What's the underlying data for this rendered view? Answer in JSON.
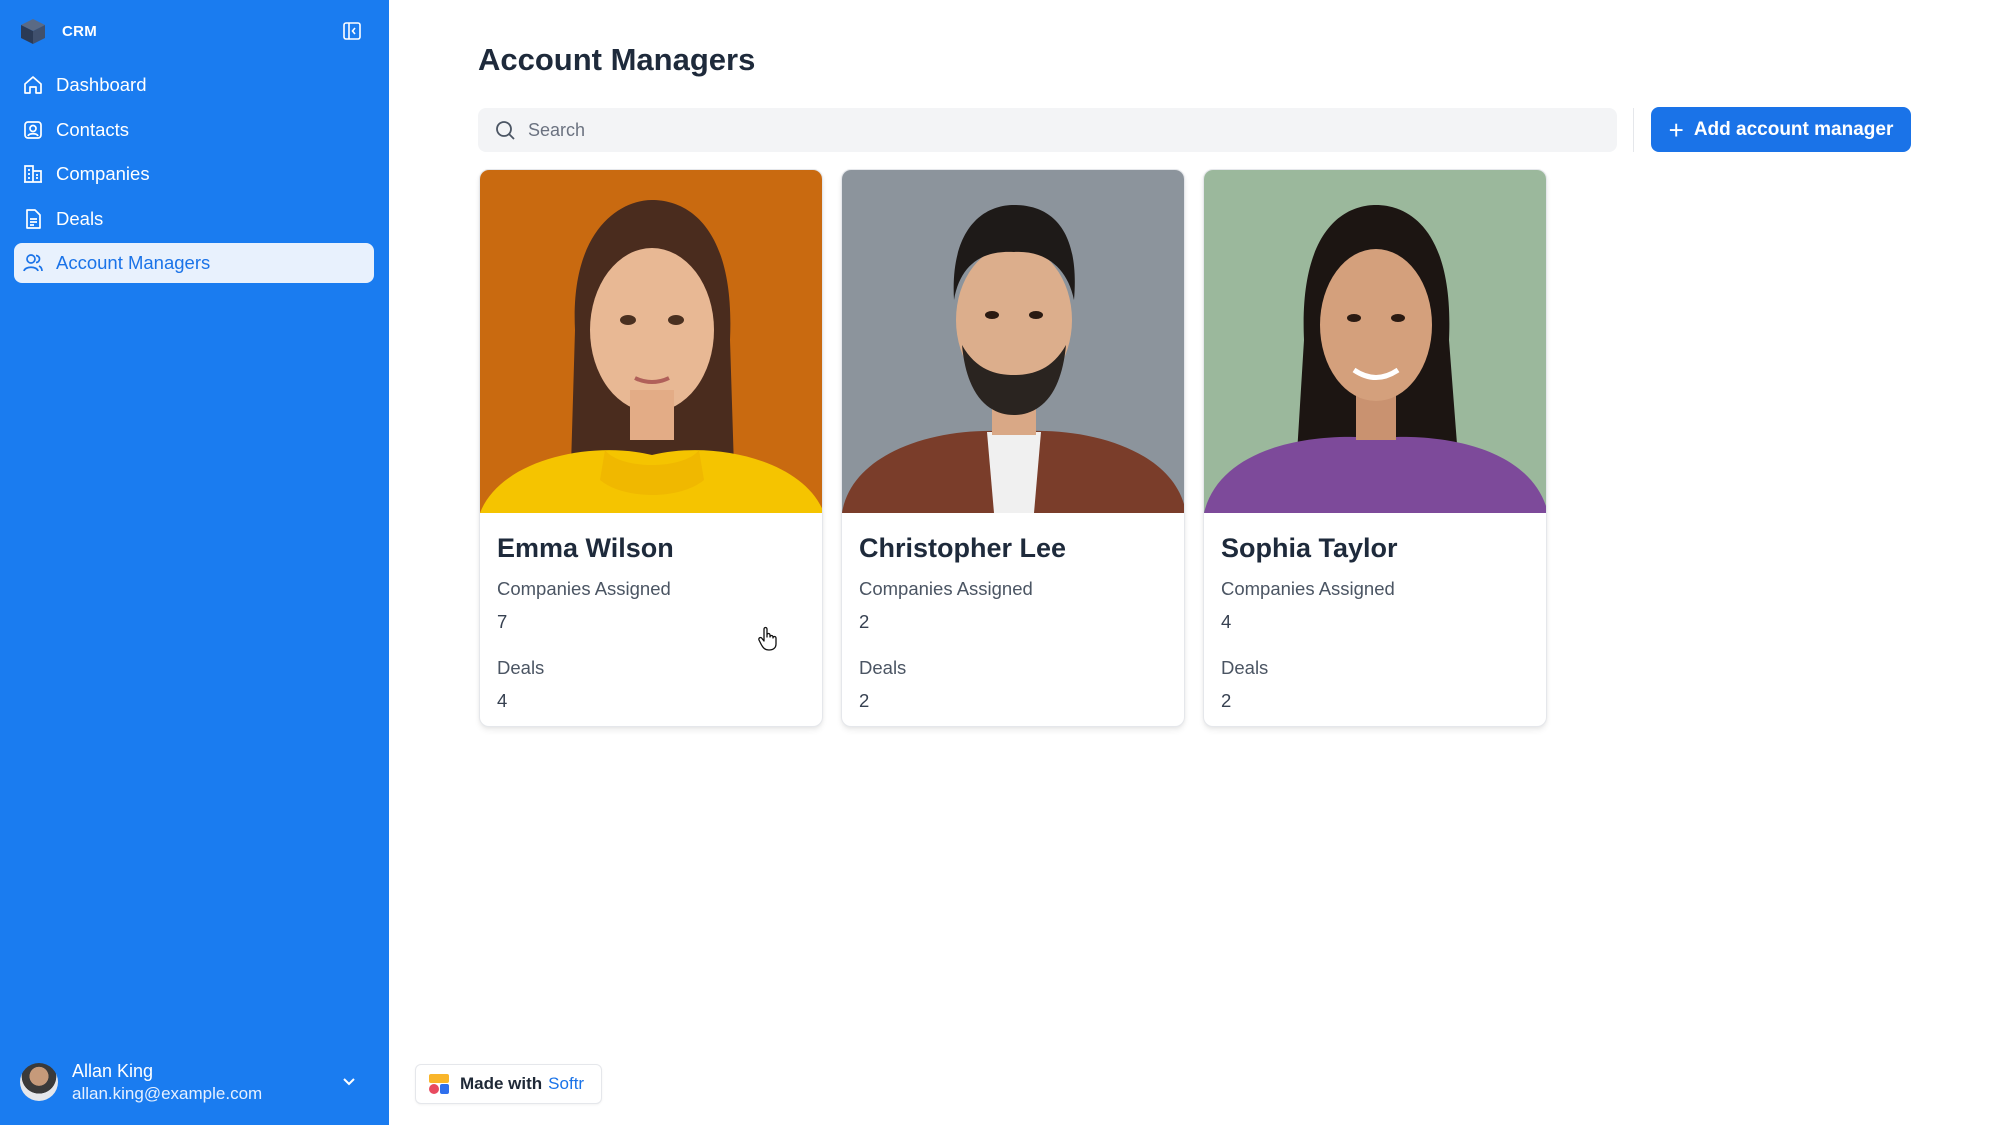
{
  "sidebar": {
    "app_name": "CRM",
    "items": [
      {
        "label": "Dashboard",
        "icon": "home-icon"
      },
      {
        "label": "Contacts",
        "icon": "contact-card-icon"
      },
      {
        "label": "Companies",
        "icon": "building-icon"
      },
      {
        "label": "Deals",
        "icon": "document-icon"
      },
      {
        "label": "Account Managers",
        "icon": "users-icon",
        "active": true
      }
    ],
    "user": {
      "name": "Allan King",
      "email": "allan.king@example.com"
    }
  },
  "main": {
    "title": "Account Managers",
    "search_placeholder": "Search",
    "add_button_label": "Add account manager",
    "cards": [
      {
        "name": "Emma Wilson",
        "companies_label": "Companies Assigned",
        "companies": "7",
        "deals_label": "Deals",
        "deals": "4",
        "photo_bg": "#c96a10"
      },
      {
        "name": "Christopher Lee",
        "companies_label": "Companies Assigned",
        "companies": "2",
        "deals_label": "Deals",
        "deals": "2",
        "photo_bg": "#8c949c"
      },
      {
        "name": "Sophia Taylor",
        "companies_label": "Companies Assigned",
        "companies": "4",
        "deals_label": "Deals",
        "deals": "2",
        "photo_bg": "#9bb89c"
      }
    ]
  },
  "footer_badge": {
    "text": "Made with",
    "brand": "Softr"
  },
  "colors": {
    "sidebar": "#1a7cf0",
    "accent": "#1a73e8",
    "active_bg": "#e8f1fd"
  }
}
